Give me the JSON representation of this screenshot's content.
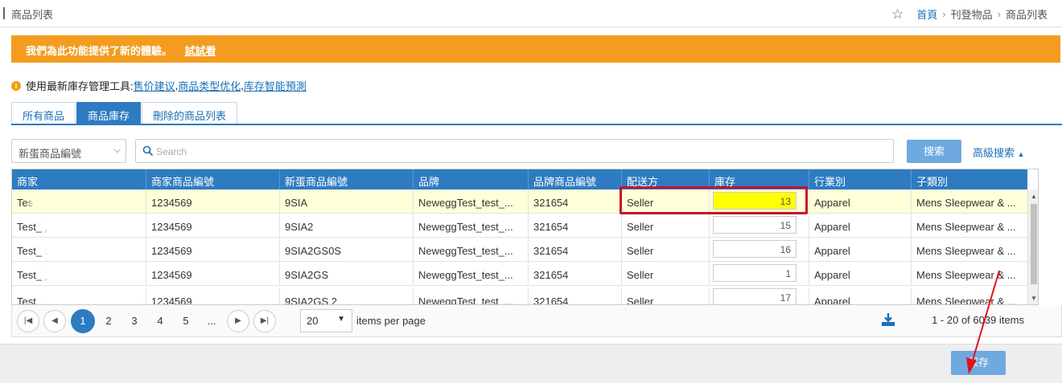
{
  "header": {
    "title": "商品列表",
    "breadcrumb": [
      "首頁",
      "刊登物品",
      "商品列表"
    ]
  },
  "banner": {
    "text": "我們為此功能提供了新的體驗。",
    "link": "試試看"
  },
  "tools": {
    "label": "使用最新庫存管理工具:",
    "links": [
      "售价建议",
      "商品类型优化",
      "库存智能預測"
    ]
  },
  "tabs": [
    "所有商品",
    "商品庫存",
    "刪除的商品列表"
  ],
  "search": {
    "select_value": "新蛋商品編號",
    "placeholder": "Search",
    "button": "搜索",
    "advanced": "高級搜索"
  },
  "grid": {
    "columns": [
      "商家",
      "商家商品編號",
      "新蛋商品編號",
      "品牌",
      "品牌商品編號",
      "配送方",
      "庫存",
      "行業別",
      "子類別"
    ],
    "rows": [
      {
        "seller": "Tes",
        "seller_num": "1234569",
        "newegg_num": "9SIA",
        "brand": "NeweggTest_test_...",
        "brand_num": "321654",
        "ship": "Seller",
        "stock": "13",
        "industry": "Apparel",
        "sub": "Mens Sleepwear & ..."
      },
      {
        "seller": "Test_                )",
        "seller_num": "1234569",
        "newegg_num": "9SIA2",
        "brand": "NeweggTest_test_...",
        "brand_num": "321654",
        "ship": "Seller",
        "stock": "15",
        "industry": "Apparel",
        "sub": "Mens Sleepwear & ..."
      },
      {
        "seller": "Test_                S)",
        "seller_num": "1234569",
        "newegg_num": "9SIA2GS0S",
        "brand": "NeweggTest_test_...",
        "brand_num": "321654",
        "ship": "Seller",
        "stock": "16",
        "industry": "Apparel",
        "sub": "Mens Sleepwear & ..."
      },
      {
        "seller": "Test_                )",
        "seller_num": "1234569",
        "newegg_num": "9SIA2GS",
        "brand": "NeweggTest_test_...",
        "brand_num": "321654",
        "ship": "Seller",
        "stock": "1",
        "industry": "Apparel",
        "sub": "Mens Sleepwear & ..."
      },
      {
        "seller": "Test_                S)",
        "seller_num": "1234569",
        "newegg_num": "9SIA2GS          2",
        "brand": "NeweggTest_test_...",
        "brand_num": "321654",
        "ship": "Seller",
        "stock": "17",
        "industry": "Apparel",
        "sub": "Mens Sleepwear & ..."
      }
    ]
  },
  "pager": {
    "pages": [
      "1",
      "2",
      "3",
      "4",
      "5",
      "..."
    ],
    "page_size": "20",
    "items_label": "items per page",
    "info": "1 - 20 of 6039 items"
  },
  "footer": {
    "save": "保存"
  },
  "colors": {
    "accent": "#2e7bc2",
    "banner": "#f39c1f",
    "highlight": "#ffff00",
    "annotation": "#c8102e"
  }
}
